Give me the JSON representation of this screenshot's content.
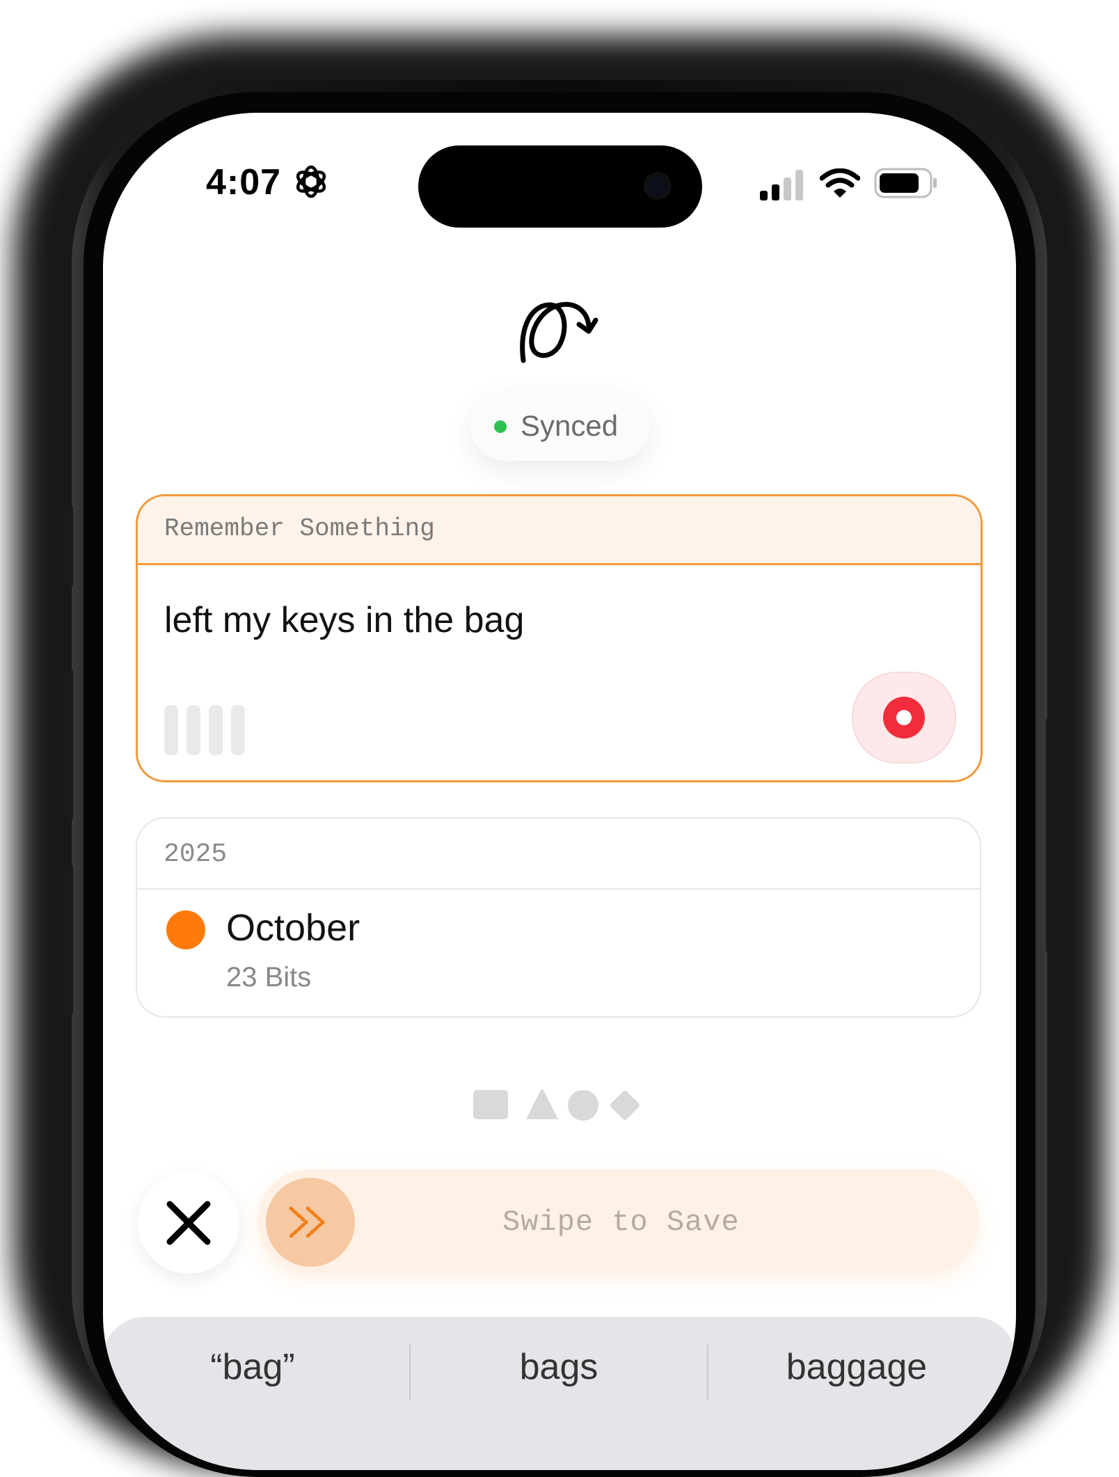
{
  "status_bar": {
    "time": "4:07",
    "settings_icon": "gear-icon",
    "signal_icon": "cellular-signal-icon",
    "wifi_icon": "wifi-icon",
    "battery_icon": "battery-icon"
  },
  "app": {
    "logo_icon": "loop-arrow-logo-icon",
    "sync_status": "Synced",
    "sync_color": "#2fc14f"
  },
  "capture_card": {
    "title": "Remember Something",
    "text": "left my keys in the bag",
    "accent": "#f29a3a",
    "record_icon": "record-icon",
    "waveform_icon": "waveform-bars-icon"
  },
  "timeline": {
    "year": "2025",
    "entries": [
      {
        "month": "October",
        "count": "23 Bits",
        "dot_color": "#ff7a0a"
      }
    ]
  },
  "shape_filters": [
    "square-icon",
    "triangle-icon",
    "circle-icon",
    "diamond-icon"
  ],
  "actions": {
    "cancel_icon": "close-icon",
    "swipe_label": "Swipe to Save",
    "swipe_icon": "double-chevron-right-icon"
  },
  "keyboard": {
    "suggestions": [
      "“bag”",
      "bags",
      "baggage"
    ]
  }
}
